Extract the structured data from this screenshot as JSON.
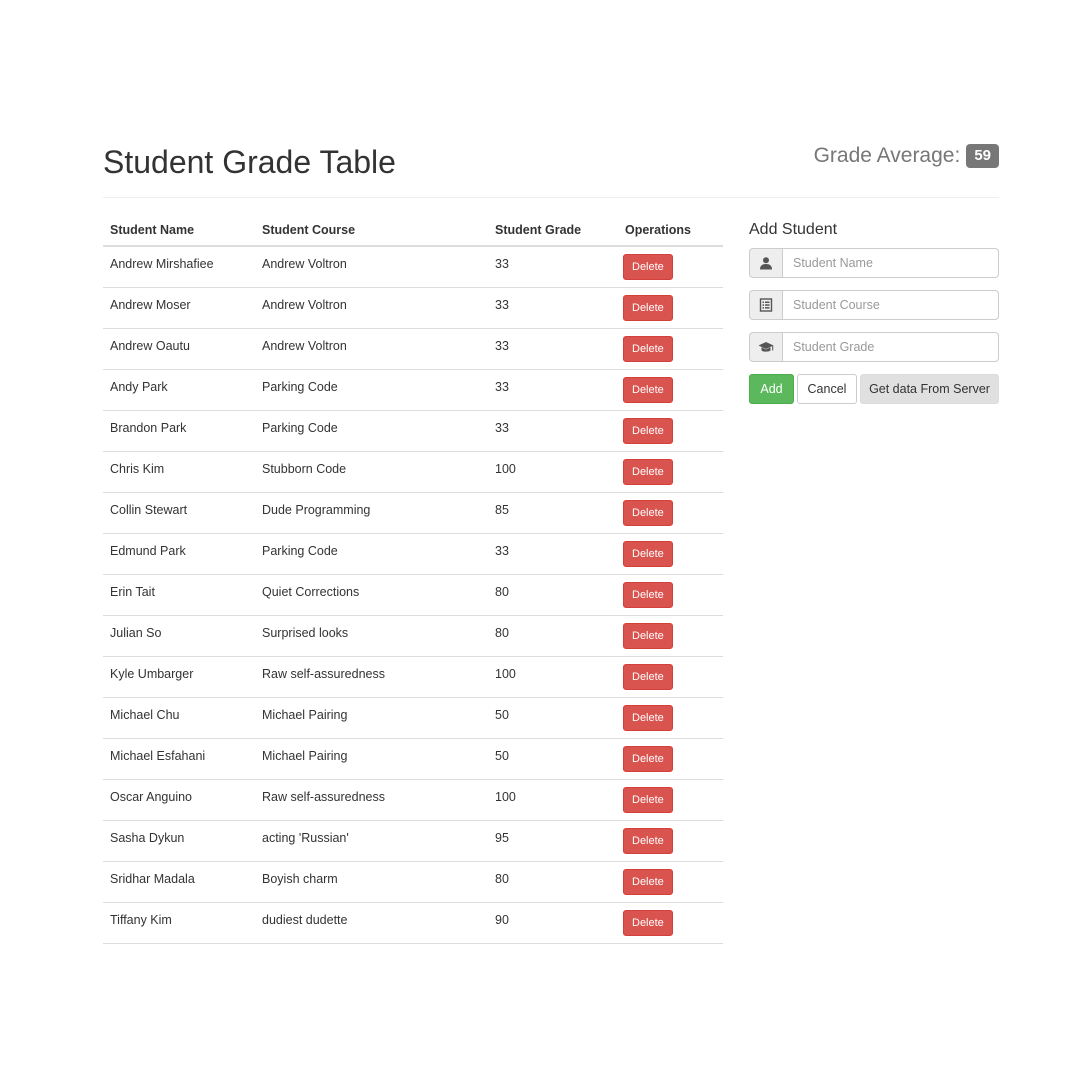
{
  "header": {
    "title": "Student Grade Table",
    "average_label": "Grade Average:",
    "average_value": "59"
  },
  "table": {
    "columns": [
      "Student Name",
      "Student Course",
      "Student Grade",
      "Operations"
    ],
    "delete_label": "Delete",
    "rows": [
      {
        "name": "Andrew Mirshafiee",
        "course": "Andrew Voltron",
        "grade": "33"
      },
      {
        "name": "Andrew Moser",
        "course": "Andrew Voltron",
        "grade": "33"
      },
      {
        "name": "Andrew Oautu",
        "course": "Andrew Voltron",
        "grade": "33"
      },
      {
        "name": "Andy Park",
        "course": "Parking Code",
        "grade": "33"
      },
      {
        "name": "Brandon Park",
        "course": "Parking Code",
        "grade": "33"
      },
      {
        "name": "Chris Kim",
        "course": "Stubborn Code",
        "grade": "100"
      },
      {
        "name": "Collin Stewart",
        "course": "Dude Programming",
        "grade": "85"
      },
      {
        "name": "Edmund Park",
        "course": "Parking Code",
        "grade": "33"
      },
      {
        "name": "Erin Tait",
        "course": "Quiet Corrections",
        "grade": "80"
      },
      {
        "name": "Julian So",
        "course": "Surprised looks",
        "grade": "80"
      },
      {
        "name": "Kyle Umbarger",
        "course": "Raw self-assuredness",
        "grade": "100"
      },
      {
        "name": "Michael Chu",
        "course": "Michael Pairing",
        "grade": "50"
      },
      {
        "name": "Michael Esfahani",
        "course": "Michael Pairing",
        "grade": "50"
      },
      {
        "name": "Oscar Anguino",
        "course": "Raw self-assuredness",
        "grade": "100"
      },
      {
        "name": "Sasha Dykun",
        "course": "acting 'Russian'",
        "grade": "95"
      },
      {
        "name": "Sridhar Madala",
        "course": "Boyish charm",
        "grade": "80"
      },
      {
        "name": "Tiffany Kim",
        "course": "dudiest dudette",
        "grade": "90"
      }
    ]
  },
  "form": {
    "title": "Add Student",
    "name_placeholder": "Student Name",
    "course_placeholder": "Student Course",
    "grade_placeholder": "Student Grade",
    "name_icon": "user-icon",
    "course_icon": "list-alt-icon",
    "grade_icon": "graduation-cap-icon",
    "add_label": "Add",
    "cancel_label": "Cancel",
    "server_label": "Get data From Server"
  },
  "colors": {
    "delete": "#d9534f",
    "add": "#5cb85c",
    "badge": "#777777"
  }
}
